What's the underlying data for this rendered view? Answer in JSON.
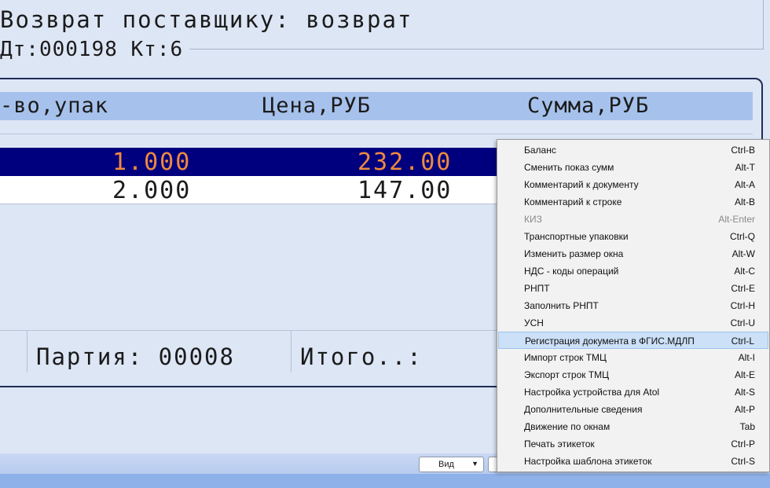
{
  "header": {
    "title": "Возврат поставщику: возврат",
    "accounts": "Дт:000198 Кт:6"
  },
  "table": {
    "columns": [
      "-во,упак",
      "Цена,РУБ",
      "Сумма,РУБ"
    ],
    "rows": [
      {
        "qty": "1.000",
        "price": "232.00",
        "selected": true
      },
      {
        "qty": "2.000",
        "price": "147.00",
        "selected": false
      }
    ]
  },
  "footer": {
    "batch": "Партия: 00008",
    "total": "Итого..:"
  },
  "status_bar": {
    "view_label": "Вид"
  },
  "context_menu": {
    "items": [
      {
        "label": "Баланс",
        "shortcut": "Ctrl-B",
        "enabled": true
      },
      {
        "label": "Сменить показ сумм",
        "shortcut": "Alt-T",
        "enabled": true
      },
      {
        "label": "Комментарий к документу",
        "shortcut": "Alt-A",
        "enabled": true
      },
      {
        "label": "Комментарий к строке",
        "shortcut": "Alt-B",
        "enabled": true
      },
      {
        "label": "КИЗ",
        "shortcut": "Alt-Enter",
        "enabled": false
      },
      {
        "label": "Транспортные упаковки",
        "shortcut": "Ctrl-Q",
        "enabled": true
      },
      {
        "label": "Изменить размер окна",
        "shortcut": "Alt-W",
        "enabled": true
      },
      {
        "label": "НДС - коды операций",
        "shortcut": "Alt-C",
        "enabled": true
      },
      {
        "label": "РНПТ",
        "shortcut": "Ctrl-E",
        "enabled": true
      },
      {
        "label": "Заполнить РНПТ",
        "shortcut": "Ctrl-H",
        "enabled": true
      },
      {
        "label": "УСН",
        "shortcut": "Ctrl-U",
        "enabled": true
      },
      {
        "label": "Регистрация документа в ФГИС.МДЛП",
        "shortcut": "Ctrl-L",
        "enabled": true,
        "highlighted": true
      },
      {
        "label": "Импорт строк ТМЦ",
        "shortcut": "Alt-I",
        "enabled": true
      },
      {
        "label": "Экспорт строк ТМЦ",
        "shortcut": "Alt-E",
        "enabled": true
      },
      {
        "label": "Настройка устройства для Atol",
        "shortcut": "Alt-S",
        "enabled": true
      },
      {
        "label": "Дополнительные сведения",
        "shortcut": "Alt-P",
        "enabled": true
      },
      {
        "label": "Движение по окнам",
        "shortcut": "Tab",
        "enabled": true
      },
      {
        "label": "Печать этикеток",
        "shortcut": "Ctrl-P",
        "enabled": true
      },
      {
        "label": "Настройка шаблона этикеток",
        "shortcut": "Ctrl-S",
        "enabled": true
      }
    ]
  },
  "colors": {
    "background": "#dde6f5",
    "header_row": "#a6c2ec",
    "selected_row": "#00007e",
    "selected_text": "#ef8a3e",
    "menu_highlight": "#cce0f7"
  }
}
